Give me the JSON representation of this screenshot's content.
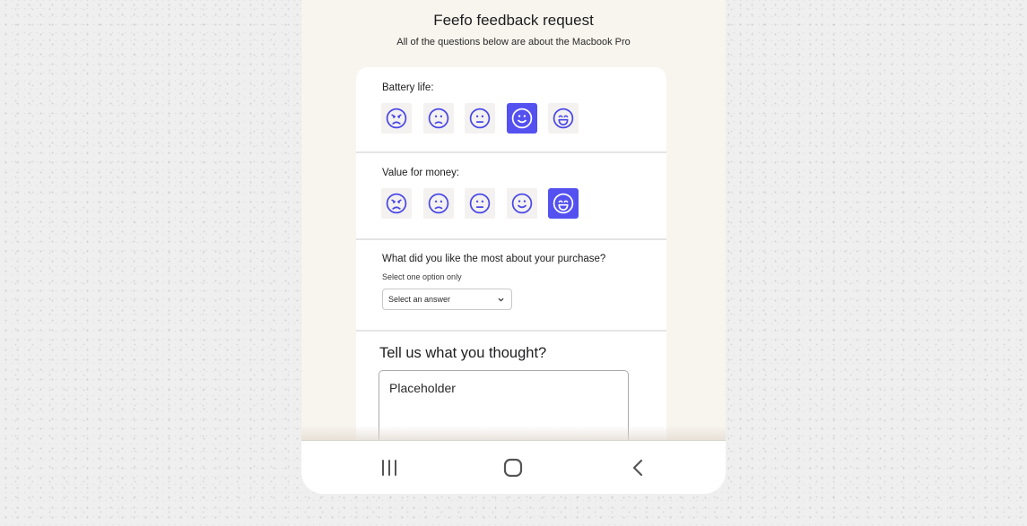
{
  "header": {
    "title": "Feefo feedback request",
    "subtitle": "All of the questions below are about the Macbook Pro"
  },
  "questions": {
    "battery": {
      "label": "Battery life:",
      "selected_index": 3,
      "options": [
        "very-dissatisfied-icon",
        "dissatisfied-icon",
        "neutral-icon",
        "satisfied-icon",
        "very-satisfied-icon"
      ]
    },
    "value": {
      "label": "Value for money:",
      "selected_index": 4,
      "options": [
        "very-dissatisfied-icon",
        "dissatisfied-icon",
        "neutral-icon",
        "satisfied-icon",
        "very-satisfied-icon"
      ]
    },
    "like": {
      "label": "What did you like the most about your purchase?",
      "helper": "Select one option only",
      "select_value": "Select an answer"
    },
    "thought": {
      "label": "Tell us what you thought?",
      "placeholder": "Placeholder"
    }
  },
  "colors": {
    "accent": "#5451f0",
    "emoji_stroke": "#4a47e8",
    "emoji_bg": "#f4f2f0",
    "page_bg": "#f8f4ee"
  },
  "navbar": {
    "items": [
      "recent-apps-icon",
      "home-icon",
      "back-icon"
    ]
  }
}
